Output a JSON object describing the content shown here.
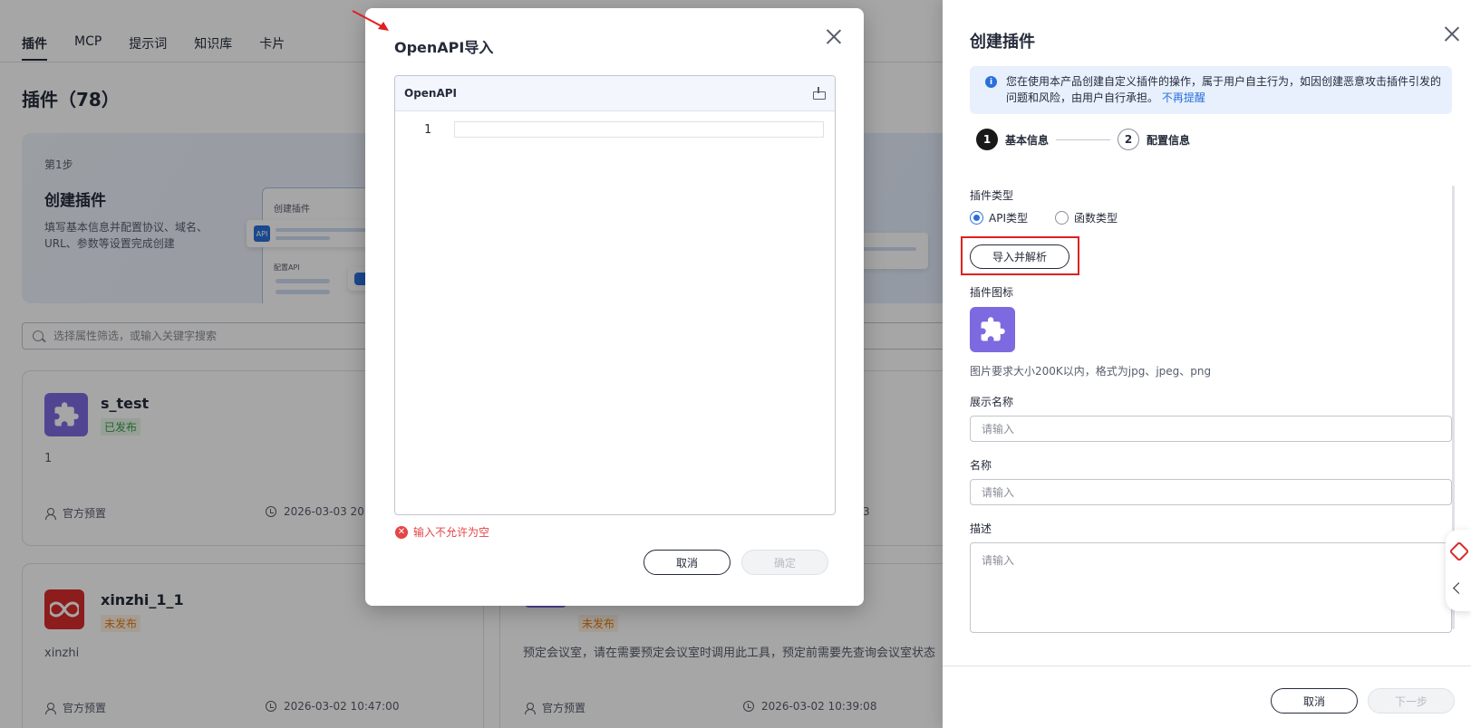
{
  "tabs": [
    {
      "label": "插件",
      "active": true
    },
    {
      "label": "MCP",
      "active": false
    },
    {
      "label": "提示词",
      "active": false
    },
    {
      "label": "知识库",
      "active": false
    },
    {
      "label": "卡片",
      "active": false
    }
  ],
  "page_title": "插件（78）",
  "banner": {
    "step": "第1步",
    "title": "创建插件",
    "desc": "填写基本信息并配置协议、域名、URL、参数等设置完成创建",
    "mock_title": "创建插件",
    "mock_badge": "API",
    "mock_sub": "配置API"
  },
  "search": {
    "placeholder": "选择属性筛选，或输入关键字搜索"
  },
  "cards": [
    {
      "name": "s_test",
      "status": "已发布",
      "desc": "1",
      "owner": "官方预置",
      "time": "2026-03-03 20:"
    },
    {
      "name": "xinzhi_1_1",
      "status": "未发布",
      "desc": "xinzhi",
      "owner": "官方预置",
      "time": "2026-03-02 10:47:00"
    },
    {
      "name": "",
      "status": "未发布",
      "desc": "预定会议室，请在需要预定会议室时调用此工具，预定前需要先查询会议室状态",
      "owner": "官方预置",
      "time": "2026-03-02 10:39:08"
    }
  ],
  "hidden_fragment": "3",
  "dialog": {
    "title": "OpenAPI导入",
    "editor_label": "OpenAPI",
    "line_number": "1",
    "error": "输入不允许为空",
    "cancel": "取消",
    "confirm": "确定"
  },
  "panel": {
    "title": "创建插件",
    "notice_text": "您在使用本产品创建自定义插件的操作，属于用户自主行为，如因创建恶意攻击插件引发的问题和风险，由用户自行承担。",
    "notice_link": "不再提醒",
    "steps": [
      {
        "num": "1",
        "label": "基本信息"
      },
      {
        "num": "2",
        "label": "配置信息"
      }
    ],
    "type_label": "插件类型",
    "type_options": [
      {
        "label": "API类型",
        "selected": true
      },
      {
        "label": "函数类型",
        "selected": false
      }
    ],
    "import_button": "导入并解析",
    "icon_label": "插件图标",
    "icon_hint": "图片要求大小200K以内，格式为jpg、jpeg、png",
    "display_name_label": "展示名称",
    "display_name_placeholder": "请输入",
    "name_label": "名称",
    "name_placeholder": "请输入",
    "desc_label": "描述",
    "desc_placeholder": "请输入",
    "cancel": "取消",
    "next": "下一步"
  },
  "colors": {
    "accent": "#2a6fdb",
    "plugin_icon": "#7d6ae0",
    "error": "#e54545",
    "highlight": "#e02020"
  }
}
